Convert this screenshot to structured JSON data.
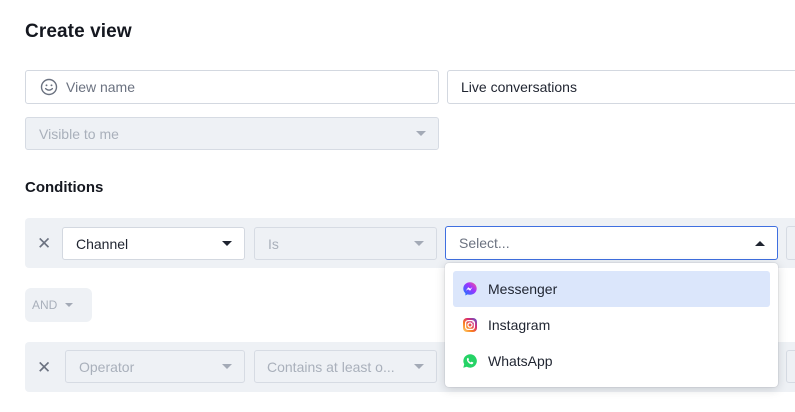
{
  "page": {
    "title": "Create view"
  },
  "form": {
    "name_placeholder": "View name",
    "name_value": "Live conversations",
    "visibility": "Visible to me"
  },
  "conditions": {
    "heading": "Conditions",
    "row1": {
      "field": "Channel",
      "operator": "Is",
      "value_placeholder": "Select..."
    },
    "logic": "AND",
    "row2": {
      "field": "Operator",
      "operator": "Contains at least o..."
    }
  },
  "dropdown": {
    "options": [
      {
        "label": "Messenger",
        "icon": "messenger-icon",
        "highlighted": true
      },
      {
        "label": "Instagram",
        "icon": "instagram-icon",
        "highlighted": false
      },
      {
        "label": "WhatsApp",
        "icon": "whatsapp-icon",
        "highlighted": false
      }
    ]
  },
  "colors": {
    "focus_border": "#3f6fe0",
    "highlight": "#dbe6fb",
    "disabled_bg": "#eef1f5",
    "whatsapp": "#25d366"
  }
}
